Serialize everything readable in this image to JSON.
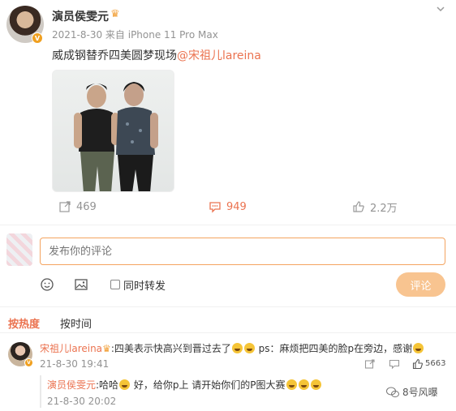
{
  "post": {
    "author": "演员侯雯元",
    "verified_badge": "V",
    "meta": "2021-8-30 来自 iPhone 11 Pro Max",
    "text_prefix": "威成钢替乔四美圆梦现场",
    "mention": "@宋祖儿lareina",
    "photo_icon": "photo-of-two-men"
  },
  "actions": {
    "repost_count": "469",
    "comment_count": "949",
    "like_count": "2.2万"
  },
  "composer": {
    "placeholder": "发布你的评论",
    "repost_label": "同时转发",
    "submit_label": "评论"
  },
  "sort_tabs": {
    "hot": "按热度",
    "time": "按时间"
  },
  "comment": {
    "author": "宋祖儿lareina",
    "text_a": ":四美表示快高兴到晋过去了",
    "text_b": " ps：麻烦把四美的脸p在旁边，感谢",
    "time": "21-8-30 19:41",
    "like_count": "5663"
  },
  "reply": {
    "author": "演员侯雯元",
    "text_a": ":哈哈",
    "text_b": " 好，给你p上 请开始你们的P图大赛",
    "time": "21-8-30 20:02"
  },
  "watermark": {
    "text": "8号风曝"
  },
  "colors": {
    "accent": "#eb7350",
    "input_border": "#f4a460",
    "submit_bg": "#f8c490",
    "muted": "#939393"
  }
}
